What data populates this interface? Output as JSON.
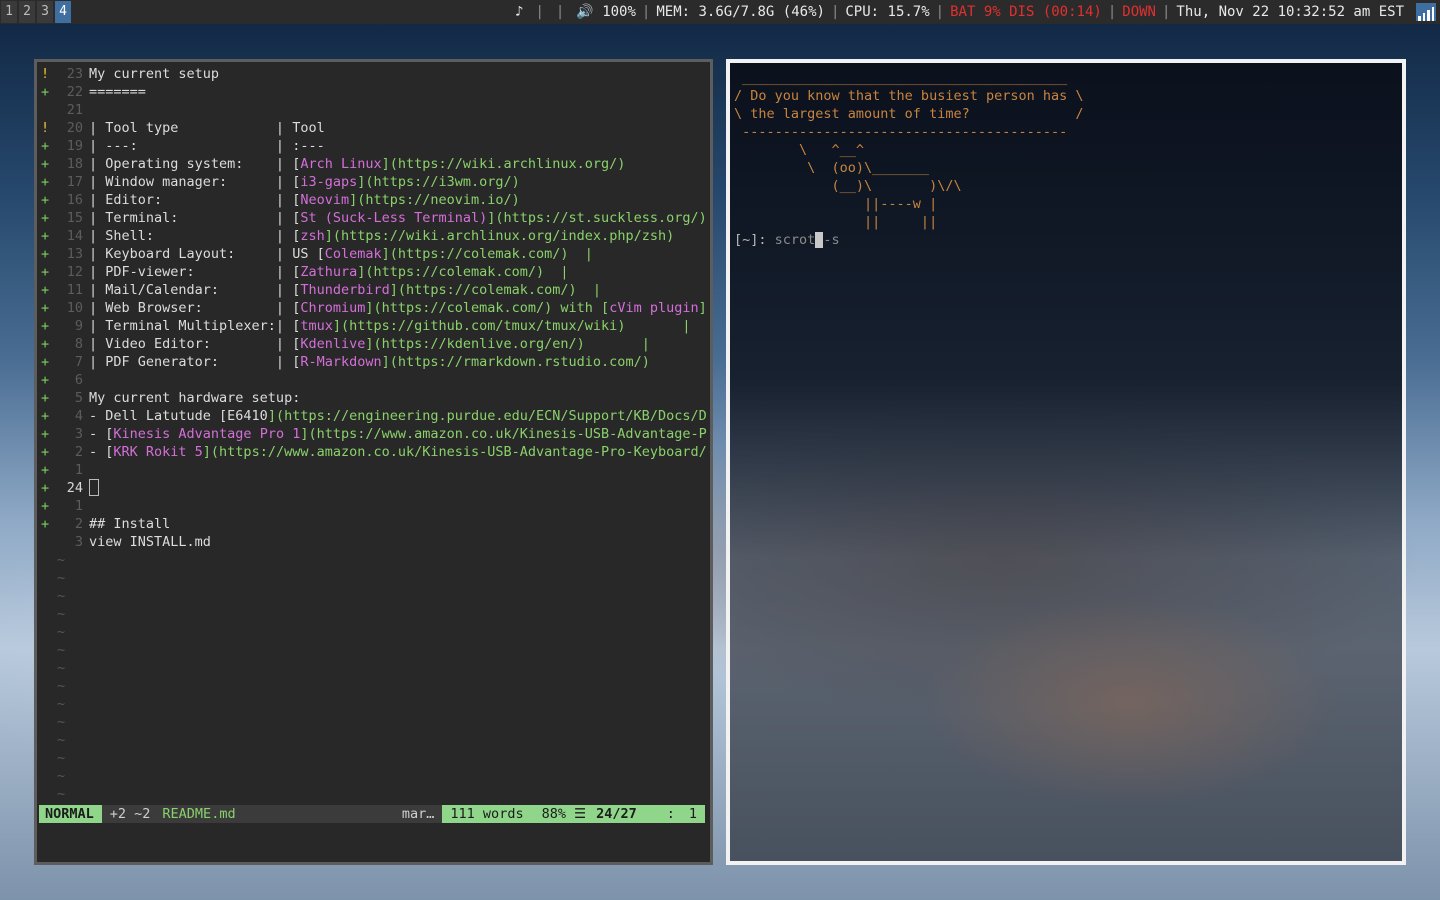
{
  "bar": {
    "workspaces": [
      "1",
      "2",
      "3",
      "4"
    ],
    "active_workspace": "4",
    "music": "♪",
    "pipe1": "|",
    "pipe2": "|",
    "volume": "🔊 100%",
    "mem": "MEM: 3.6G/7.8G (46%)",
    "cpu": "CPU: 15.7%",
    "battery": "BAT 9% DIS (00:14)",
    "net": "DOWN",
    "datetime": "Thu, Nov 22 10:32:52 am EST"
  },
  "editor": {
    "lines": [
      {
        "sign": "!",
        "num": "23",
        "text": "My current setup"
      },
      {
        "sign": "+",
        "num": "22",
        "text": "======="
      },
      {
        "sign": "",
        "num": "21",
        "text": ""
      },
      {
        "sign": "!",
        "num": "20",
        "text": "| Tool type            | Tool"
      },
      {
        "sign": "+",
        "num": "19",
        "text": "| ---:                 | :---"
      },
      {
        "sign": "+",
        "num": "18",
        "pre": "| Operating system:    | [",
        "name": "Arch Linux",
        "post": "](https://wiki.archlinux.org/)"
      },
      {
        "sign": "+",
        "num": "17",
        "pre": "| Window manager:      | [",
        "name": "i3-gaps",
        "post": "](https://i3wm.org/)"
      },
      {
        "sign": "+",
        "num": "16",
        "pre": "| Editor:              | [",
        "name": "Neovim",
        "post": "](https://neovim.io/)"
      },
      {
        "sign": "+",
        "num": "15",
        "pre": "| Terminal:            | [",
        "name": "St (Suck-Less Terminal)",
        "post": "](https://st.suckless.org/)"
      },
      {
        "sign": "+",
        "num": "14",
        "pre": "| Shell:               | [",
        "name": "zsh",
        "post": "](https://wiki.archlinux.org/index.php/zsh)"
      },
      {
        "sign": "+",
        "num": "13",
        "pre": "| Keyboard Layout:     | US [",
        "name": "Colemak",
        "post": "](https://colemak.com/)  |"
      },
      {
        "sign": "+",
        "num": "12",
        "pre": "| PDF-viewer:          | [",
        "name": "Zathura",
        "post": "](https://colemak.com/)  |"
      },
      {
        "sign": "+",
        "num": "11",
        "pre": "| Mail/Calendar:       | [",
        "name": "Thunderbird",
        "post": "](https://colemak.com/)  |"
      },
      {
        "sign": "+",
        "num": "10",
        "pre": "| Web Browser:         | [",
        "name": "Chromium",
        "post": "](https://colemak.com/) with [",
        "name2": "cVim plugin",
        "post2": "]("
      },
      {
        "sign": "+",
        "num": "9",
        "pre": "| Terminal Multiplexer:| [",
        "name": "tmux",
        "post": "](https://github.com/tmux/tmux/wiki)       |"
      },
      {
        "sign": "+",
        "num": "8",
        "pre": "| Video Editor:        | [",
        "name": "Kdenlive",
        "post": "](https://kdenlive.org/en/)       |"
      },
      {
        "sign": "+",
        "num": "7",
        "pre": "| PDF Generator:       | [",
        "name": "R-Markdown",
        "post": "](https://rmarkdown.rstudio.com/)       |"
      },
      {
        "sign": "+",
        "num": "6",
        "text": ""
      },
      {
        "sign": "+",
        "num": "5",
        "text": "My current hardware setup:"
      },
      {
        "sign": "+",
        "num": "4",
        "pre": "- Dell Latutude [",
        "name": "E6410",
        "post": "](https://engineering.purdue.edu/ECN/Support/KB/Docs/De",
        "plainname": true
      },
      {
        "sign": "+",
        "num": "3",
        "pre": "- [",
        "name": "Kinesis Advantage Pro 1",
        "post": "](https://www.amazon.co.uk/Kinesis-USB-Advantage-Pr"
      },
      {
        "sign": "+",
        "num": "2",
        "pre": "- [",
        "name": "KRK Rokit 5",
        "post": "](https://www.amazon.co.uk/Kinesis-USB-Advantage-Pro-Keyboard/d"
      },
      {
        "sign": "+",
        "num": "1",
        "text": ""
      },
      {
        "sign": "+",
        "num": "24",
        "text": "",
        "current": true
      },
      {
        "sign": "+",
        "num": "1",
        "text": ""
      },
      {
        "sign": "+",
        "num": "2",
        "text": "## Install"
      },
      {
        "sign": "",
        "num": "3",
        "text": "view INSTALL.md"
      }
    ],
    "tilde": "~",
    "tilde_count": 14
  },
  "statusline": {
    "mode": "NORMAL",
    "diff": "+2 ~2",
    "file": "README.md",
    "filetype": "mar…",
    "words": "111 words",
    "percent": "88%",
    "menu_icon": "☰",
    "position": "24/27",
    "col_sep": ":",
    "col": "1"
  },
  "terminal": {
    "cowsay": [
      " ________________________________________ ",
      "/ Do you know that the busiest person has \\",
      "\\ the largest amount of time?             /",
      " ---------------------------------------- ",
      "        \\   ^__^",
      "         \\  (oo)\\_______",
      "            (__)\\       )\\/\\",
      "                ||----w |",
      "                ||     ||"
    ],
    "prompt": "[~]: ",
    "typed_before": "scrot",
    "cursor_char": " ",
    "typed_after": "-s"
  }
}
